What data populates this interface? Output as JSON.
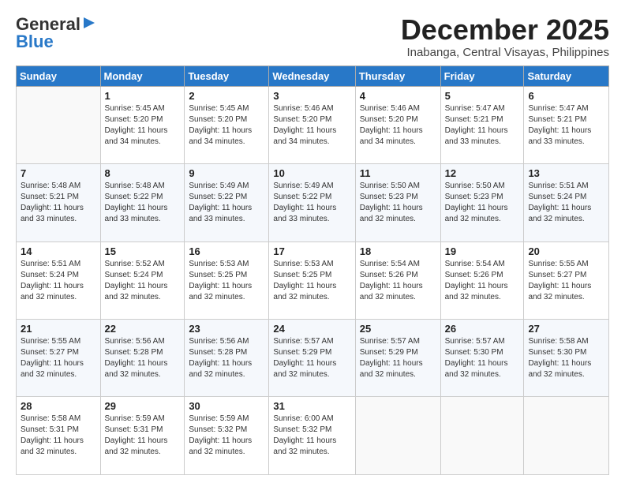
{
  "header": {
    "logo_general": "General",
    "logo_blue": "Blue",
    "month": "December 2025",
    "location": "Inabanga, Central Visayas, Philippines"
  },
  "days_of_week": [
    "Sunday",
    "Monday",
    "Tuesday",
    "Wednesday",
    "Thursday",
    "Friday",
    "Saturday"
  ],
  "weeks": [
    [
      {
        "day": "",
        "info": ""
      },
      {
        "day": "1",
        "info": "Sunrise: 5:45 AM\nSunset: 5:20 PM\nDaylight: 11 hours\nand 34 minutes."
      },
      {
        "day": "2",
        "info": "Sunrise: 5:45 AM\nSunset: 5:20 PM\nDaylight: 11 hours\nand 34 minutes."
      },
      {
        "day": "3",
        "info": "Sunrise: 5:46 AM\nSunset: 5:20 PM\nDaylight: 11 hours\nand 34 minutes."
      },
      {
        "day": "4",
        "info": "Sunrise: 5:46 AM\nSunset: 5:20 PM\nDaylight: 11 hours\nand 34 minutes."
      },
      {
        "day": "5",
        "info": "Sunrise: 5:47 AM\nSunset: 5:21 PM\nDaylight: 11 hours\nand 33 minutes."
      },
      {
        "day": "6",
        "info": "Sunrise: 5:47 AM\nSunset: 5:21 PM\nDaylight: 11 hours\nand 33 minutes."
      }
    ],
    [
      {
        "day": "7",
        "info": "Sunrise: 5:48 AM\nSunset: 5:21 PM\nDaylight: 11 hours\nand 33 minutes."
      },
      {
        "day": "8",
        "info": "Sunrise: 5:48 AM\nSunset: 5:22 PM\nDaylight: 11 hours\nand 33 minutes."
      },
      {
        "day": "9",
        "info": "Sunrise: 5:49 AM\nSunset: 5:22 PM\nDaylight: 11 hours\nand 33 minutes."
      },
      {
        "day": "10",
        "info": "Sunrise: 5:49 AM\nSunset: 5:22 PM\nDaylight: 11 hours\nand 33 minutes."
      },
      {
        "day": "11",
        "info": "Sunrise: 5:50 AM\nSunset: 5:23 PM\nDaylight: 11 hours\nand 32 minutes."
      },
      {
        "day": "12",
        "info": "Sunrise: 5:50 AM\nSunset: 5:23 PM\nDaylight: 11 hours\nand 32 minutes."
      },
      {
        "day": "13",
        "info": "Sunrise: 5:51 AM\nSunset: 5:24 PM\nDaylight: 11 hours\nand 32 minutes."
      }
    ],
    [
      {
        "day": "14",
        "info": "Sunrise: 5:51 AM\nSunset: 5:24 PM\nDaylight: 11 hours\nand 32 minutes."
      },
      {
        "day": "15",
        "info": "Sunrise: 5:52 AM\nSunset: 5:24 PM\nDaylight: 11 hours\nand 32 minutes."
      },
      {
        "day": "16",
        "info": "Sunrise: 5:53 AM\nSunset: 5:25 PM\nDaylight: 11 hours\nand 32 minutes."
      },
      {
        "day": "17",
        "info": "Sunrise: 5:53 AM\nSunset: 5:25 PM\nDaylight: 11 hours\nand 32 minutes."
      },
      {
        "day": "18",
        "info": "Sunrise: 5:54 AM\nSunset: 5:26 PM\nDaylight: 11 hours\nand 32 minutes."
      },
      {
        "day": "19",
        "info": "Sunrise: 5:54 AM\nSunset: 5:26 PM\nDaylight: 11 hours\nand 32 minutes."
      },
      {
        "day": "20",
        "info": "Sunrise: 5:55 AM\nSunset: 5:27 PM\nDaylight: 11 hours\nand 32 minutes."
      }
    ],
    [
      {
        "day": "21",
        "info": "Sunrise: 5:55 AM\nSunset: 5:27 PM\nDaylight: 11 hours\nand 32 minutes."
      },
      {
        "day": "22",
        "info": "Sunrise: 5:56 AM\nSunset: 5:28 PM\nDaylight: 11 hours\nand 32 minutes."
      },
      {
        "day": "23",
        "info": "Sunrise: 5:56 AM\nSunset: 5:28 PM\nDaylight: 11 hours\nand 32 minutes."
      },
      {
        "day": "24",
        "info": "Sunrise: 5:57 AM\nSunset: 5:29 PM\nDaylight: 11 hours\nand 32 minutes."
      },
      {
        "day": "25",
        "info": "Sunrise: 5:57 AM\nSunset: 5:29 PM\nDaylight: 11 hours\nand 32 minutes."
      },
      {
        "day": "26",
        "info": "Sunrise: 5:57 AM\nSunset: 5:30 PM\nDaylight: 11 hours\nand 32 minutes."
      },
      {
        "day": "27",
        "info": "Sunrise: 5:58 AM\nSunset: 5:30 PM\nDaylight: 11 hours\nand 32 minutes."
      }
    ],
    [
      {
        "day": "28",
        "info": "Sunrise: 5:58 AM\nSunset: 5:31 PM\nDaylight: 11 hours\nand 32 minutes."
      },
      {
        "day": "29",
        "info": "Sunrise: 5:59 AM\nSunset: 5:31 PM\nDaylight: 11 hours\nand 32 minutes."
      },
      {
        "day": "30",
        "info": "Sunrise: 5:59 AM\nSunset: 5:32 PM\nDaylight: 11 hours\nand 32 minutes."
      },
      {
        "day": "31",
        "info": "Sunrise: 6:00 AM\nSunset: 5:32 PM\nDaylight: 11 hours\nand 32 minutes."
      },
      {
        "day": "",
        "info": ""
      },
      {
        "day": "",
        "info": ""
      },
      {
        "day": "",
        "info": ""
      }
    ]
  ]
}
